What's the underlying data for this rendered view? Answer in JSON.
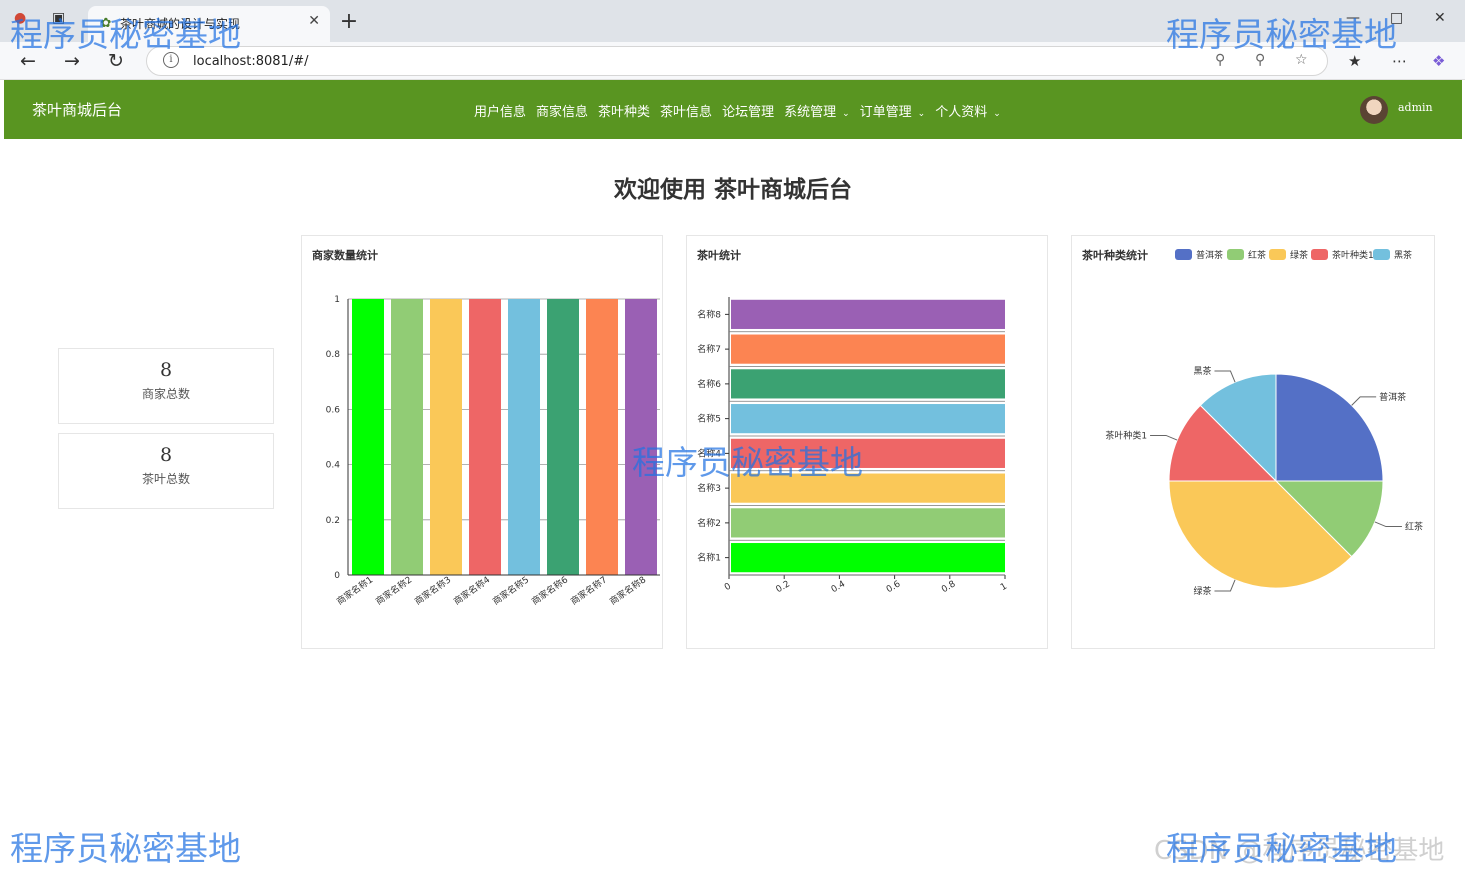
{
  "browser": {
    "tab_title": "茶叶商城的设计与实现",
    "url": "localhost:8081/#/"
  },
  "app": {
    "brand": "茶叶商城后台",
    "menu": [
      {
        "label": "用户信息",
        "dropdown": false
      },
      {
        "label": "商家信息",
        "dropdown": false
      },
      {
        "label": "茶叶种类",
        "dropdown": false
      },
      {
        "label": "茶叶信息",
        "dropdown": false
      },
      {
        "label": "论坛管理",
        "dropdown": false
      },
      {
        "label": "系统管理",
        "dropdown": true
      },
      {
        "label": "订单管理",
        "dropdown": true
      },
      {
        "label": "个人资料",
        "dropdown": true
      }
    ],
    "username": "admin",
    "welcome": "欢迎使用 茶叶商城后台",
    "stats": [
      {
        "value": "8",
        "label": "商家总数"
      },
      {
        "value": "8",
        "label": "茶叶总数"
      }
    ]
  },
  "watermarks": [
    "程序员秘密基地",
    "程序员秘密基地",
    "程序员秘密基地",
    "程序员秘密基地",
    "程序员秘密基地"
  ],
  "csdn_mark": "CSDN @程序员秘密基地",
  "chart_data": [
    {
      "type": "bar",
      "title": "商家数量统计",
      "categories": [
        "商家名称1",
        "商家名称2",
        "商家名称3",
        "商家名称4",
        "商家名称5",
        "商家名称6",
        "商家名称7",
        "商家名称8"
      ],
      "values": [
        1,
        1,
        1,
        1,
        1,
        1,
        1,
        1
      ],
      "colors": [
        "#00ff00",
        "#91cc75",
        "#fac858",
        "#ee6666",
        "#73c0de",
        "#3ba272",
        "#fc8452",
        "#9a60b4"
      ],
      "ylim": [
        0,
        1
      ],
      "yticks": [
        "0",
        "0.2",
        "0.4",
        "0.6",
        "0.8",
        "1"
      ]
    },
    {
      "type": "bar",
      "orientation": "horizontal",
      "title": "茶叶统计",
      "categories": [
        "名称1",
        "名称2",
        "名称3",
        "名称4",
        "名称5",
        "名称6",
        "名称7",
        "名称8"
      ],
      "values": [
        1,
        1,
        1,
        1,
        1,
        1,
        1,
        1
      ],
      "colors": [
        "#00ff00",
        "#91cc75",
        "#fac858",
        "#ee6666",
        "#73c0de",
        "#3ba272",
        "#fc8452",
        "#9a60b4"
      ],
      "xlim": [
        0,
        1
      ],
      "xticks": [
        "0",
        "0.2",
        "0.4",
        "0.6",
        "0.8",
        "1"
      ]
    },
    {
      "type": "pie",
      "title": "茶叶种类统计",
      "legend": [
        "普洱茶",
        "红茶",
        "绿茶",
        "茶叶种类1",
        "黑茶"
      ],
      "labels": [
        "普洱茶",
        "红茶",
        "绿茶",
        "茶叶种类1",
        "黑茶"
      ],
      "values": [
        2,
        1,
        3,
        1,
        1
      ],
      "colors": [
        "#5470c6",
        "#91cc75",
        "#fac858",
        "#ee6666",
        "#73c0de"
      ]
    }
  ]
}
